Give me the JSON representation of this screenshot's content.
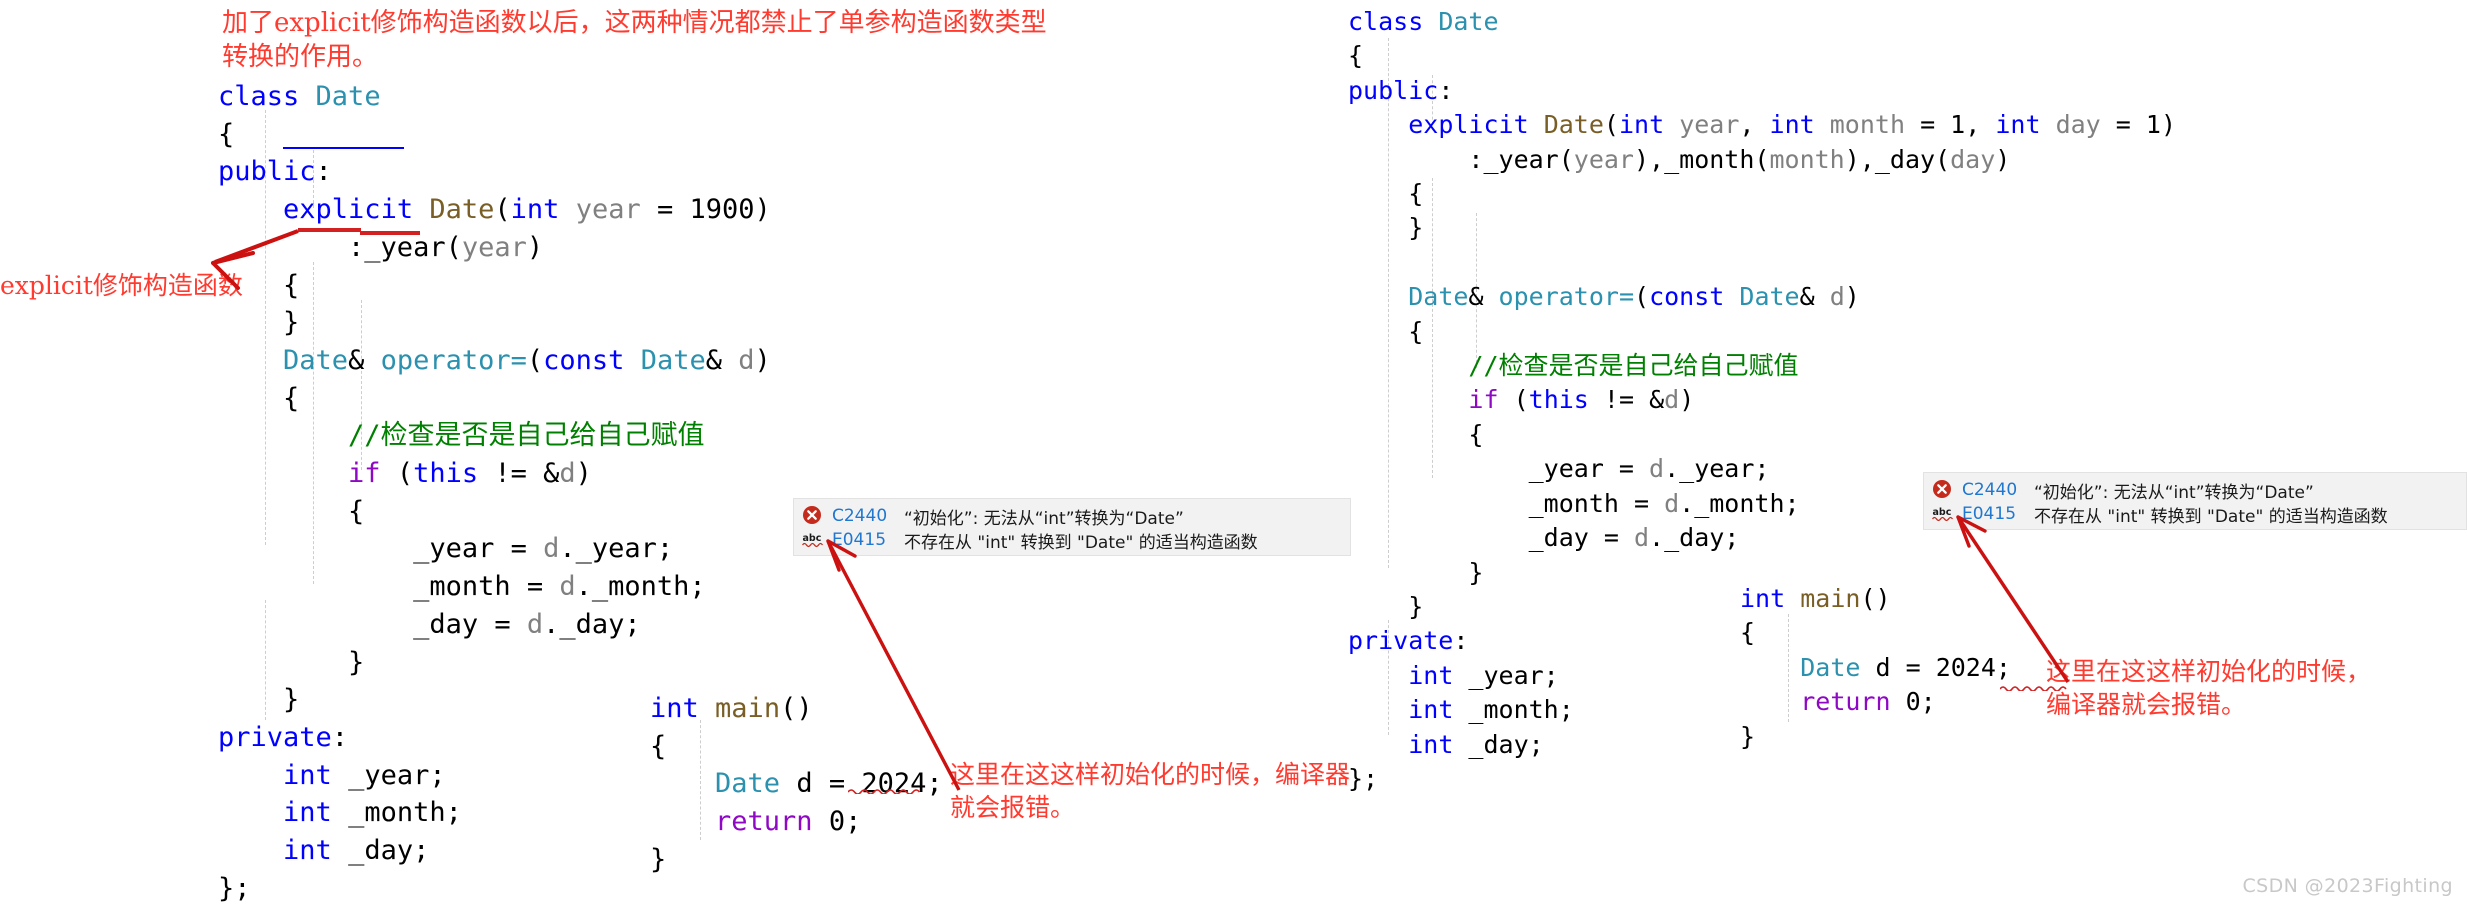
{
  "header_note": "加了explicit修饰构造函数以后，这两种情况都禁止了单参构造函数类型转换的作用。",
  "left_side_note": "explicit修饰构造函数",
  "watermark": "CSDN @2023Fighting",
  "colors": {
    "keyword": "#0000ff",
    "type": "#2b91af",
    "function": "#795e26",
    "variable": "#808080",
    "control": "#8f08c4",
    "comment": "#008000",
    "annotation_red": "#ff3b30",
    "arrow_red": "#cc1111",
    "error_code_blue": "#1f77d0",
    "tooltip_bg": "#f2f2f2",
    "background": "#ffffff"
  },
  "left_panel": {
    "lines": [
      [
        {
          "t": "class",
          "c": "kw"
        },
        {
          "t": " ",
          "c": "plain"
        },
        {
          "t": "Date",
          "c": "type"
        }
      ],
      [
        {
          "t": "{",
          "c": "plain"
        }
      ],
      [
        {
          "t": "public",
          "c": "kw"
        },
        {
          "t": ":",
          "c": "plain"
        }
      ],
      [
        {
          "t": "    ",
          "c": "plain"
        },
        {
          "t": "explicit",
          "c": "kw"
        },
        {
          "t": " ",
          "c": "plain"
        },
        {
          "t": "Date",
          "c": "fn"
        },
        {
          "t": "(",
          "c": "plain"
        },
        {
          "t": "int",
          "c": "kw"
        },
        {
          "t": " ",
          "c": "plain"
        },
        {
          "t": "year",
          "c": "var"
        },
        {
          "t": " = ",
          "c": "plain"
        },
        {
          "t": "1900",
          "c": "num"
        },
        {
          "t": ")",
          "c": "plain"
        }
      ],
      [
        {
          "t": "        :_year",
          "c": "plain"
        },
        {
          "t": "(",
          "c": "plain"
        },
        {
          "t": "year",
          "c": "var"
        },
        {
          "t": ")",
          "c": "plain"
        }
      ],
      [
        {
          "t": "    {",
          "c": "plain"
        }
      ],
      [
        {
          "t": "    }",
          "c": "plain"
        }
      ],
      [
        {
          "t": "    ",
          "c": "plain"
        },
        {
          "t": "Date",
          "c": "type"
        },
        {
          "t": "& ",
          "c": "plain"
        },
        {
          "t": "operator=",
          "c": "type"
        },
        {
          "t": "(",
          "c": "plain"
        },
        {
          "t": "const",
          "c": "kw"
        },
        {
          "t": " ",
          "c": "plain"
        },
        {
          "t": "Date",
          "c": "type"
        },
        {
          "t": "& ",
          "c": "plain"
        },
        {
          "t": "d",
          "c": "var"
        },
        {
          "t": ")",
          "c": "plain"
        }
      ],
      [
        {
          "t": "    {",
          "c": "plain"
        }
      ],
      [
        {
          "t": "        ",
          "c": "plain"
        },
        {
          "t": "//检查是否是自己给自己赋值",
          "c": "cmt"
        }
      ],
      [
        {
          "t": "        ",
          "c": "plain"
        },
        {
          "t": "if",
          "c": "ctrl"
        },
        {
          "t": " (",
          "c": "plain"
        },
        {
          "t": "this",
          "c": "kw"
        },
        {
          "t": " != &",
          "c": "plain"
        },
        {
          "t": "d",
          "c": "var"
        },
        {
          "t": ")",
          "c": "plain"
        }
      ],
      [
        {
          "t": "        {",
          "c": "plain"
        }
      ],
      [
        {
          "t": "            _year = ",
          "c": "plain"
        },
        {
          "t": "d",
          "c": "var"
        },
        {
          "t": "._year;",
          "c": "plain"
        }
      ],
      [
        {
          "t": "            _month = ",
          "c": "plain"
        },
        {
          "t": "d",
          "c": "var"
        },
        {
          "t": "._month;",
          "c": "plain"
        }
      ],
      [
        {
          "t": "            _day = ",
          "c": "plain"
        },
        {
          "t": "d",
          "c": "var"
        },
        {
          "t": "._day;",
          "c": "plain"
        }
      ],
      [
        {
          "t": "        }",
          "c": "plain"
        }
      ],
      [
        {
          "t": "    }",
          "c": "plain"
        }
      ],
      [
        {
          "t": "private",
          "c": "kw"
        },
        {
          "t": ":",
          "c": "plain"
        }
      ],
      [
        {
          "t": "    ",
          "c": "plain"
        },
        {
          "t": "int",
          "c": "kw"
        },
        {
          "t": " _year;",
          "c": "plain"
        }
      ],
      [
        {
          "t": "    ",
          "c": "plain"
        },
        {
          "t": "int",
          "c": "kw"
        },
        {
          "t": " _month;",
          "c": "plain"
        }
      ],
      [
        {
          "t": "    ",
          "c": "plain"
        },
        {
          "t": "int",
          "c": "kw"
        },
        {
          "t": " _day;",
          "c": "plain"
        }
      ],
      [
        {
          "t": "};",
          "c": "plain"
        }
      ]
    ]
  },
  "left_main": {
    "lines": [
      [
        {
          "t": "int",
          "c": "kw"
        },
        {
          "t": " ",
          "c": "plain"
        },
        {
          "t": "main",
          "c": "fn"
        },
        {
          "t": "()",
          "c": "plain"
        }
      ],
      [
        {
          "t": "{",
          "c": "plain"
        }
      ],
      [
        {
          "t": "    ",
          "c": "plain"
        },
        {
          "t": "Date",
          "c": "type"
        },
        {
          "t": " d = ",
          "c": "plain"
        },
        {
          "t": "2024",
          "c": "num"
        },
        {
          "t": ";",
          "c": "plain"
        }
      ],
      [
        {
          "t": "    ",
          "c": "plain"
        },
        {
          "t": "return",
          "c": "ctrl"
        },
        {
          "t": " ",
          "c": "plain"
        },
        {
          "t": "0",
          "c": "num"
        },
        {
          "t": ";",
          "c": "plain"
        }
      ],
      [
        {
          "t": "}",
          "c": "plain"
        }
      ]
    ]
  },
  "right_panel": {
    "lines": [
      [
        {
          "t": "class",
          "c": "kw"
        },
        {
          "t": " ",
          "c": "plain"
        },
        {
          "t": "Date",
          "c": "type"
        }
      ],
      [
        {
          "t": "{",
          "c": "plain"
        }
      ],
      [
        {
          "t": "public",
          "c": "kw"
        },
        {
          "t": ":",
          "c": "plain"
        }
      ],
      [
        {
          "t": "    ",
          "c": "plain"
        },
        {
          "t": "explicit",
          "c": "kw"
        },
        {
          "t": " ",
          "c": "plain"
        },
        {
          "t": "Date",
          "c": "fn"
        },
        {
          "t": "(",
          "c": "plain"
        },
        {
          "t": "int",
          "c": "kw"
        },
        {
          "t": " ",
          "c": "plain"
        },
        {
          "t": "year",
          "c": "var"
        },
        {
          "t": ", ",
          "c": "plain"
        },
        {
          "t": "int",
          "c": "kw"
        },
        {
          "t": " ",
          "c": "plain"
        },
        {
          "t": "month",
          "c": "var"
        },
        {
          "t": " = ",
          "c": "plain"
        },
        {
          "t": "1",
          "c": "num"
        },
        {
          "t": ", ",
          "c": "plain"
        },
        {
          "t": "int",
          "c": "kw"
        },
        {
          "t": " ",
          "c": "plain"
        },
        {
          "t": "day",
          "c": "var"
        },
        {
          "t": " = ",
          "c": "plain"
        },
        {
          "t": "1",
          "c": "num"
        },
        {
          "t": ")",
          "c": "plain"
        }
      ],
      [
        {
          "t": "        :_year",
          "c": "plain"
        },
        {
          "t": "(",
          "c": "plain"
        },
        {
          "t": "year",
          "c": "var"
        },
        {
          "t": "),_month(",
          "c": "plain"
        },
        {
          "t": "month",
          "c": "var"
        },
        {
          "t": "),_day(",
          "c": "plain"
        },
        {
          "t": "day",
          "c": "var"
        },
        {
          "t": ")",
          "c": "plain"
        }
      ],
      [
        {
          "t": "    {",
          "c": "plain"
        }
      ],
      [
        {
          "t": "    }",
          "c": "plain"
        }
      ],
      [
        {
          "t": "",
          "c": "plain"
        }
      ],
      [
        {
          "t": "    ",
          "c": "plain"
        },
        {
          "t": "Date",
          "c": "type"
        },
        {
          "t": "& ",
          "c": "plain"
        },
        {
          "t": "operator=",
          "c": "type"
        },
        {
          "t": "(",
          "c": "plain"
        },
        {
          "t": "const",
          "c": "kw"
        },
        {
          "t": " ",
          "c": "plain"
        },
        {
          "t": "Date",
          "c": "type"
        },
        {
          "t": "& ",
          "c": "plain"
        },
        {
          "t": "d",
          "c": "var"
        },
        {
          "t": ")",
          "c": "plain"
        }
      ],
      [
        {
          "t": "    {",
          "c": "plain"
        }
      ],
      [
        {
          "t": "        ",
          "c": "plain"
        },
        {
          "t": "//检查是否是自己给自己赋值",
          "c": "cmt"
        }
      ],
      [
        {
          "t": "        ",
          "c": "plain"
        },
        {
          "t": "if",
          "c": "ctrl"
        },
        {
          "t": " (",
          "c": "plain"
        },
        {
          "t": "this",
          "c": "kw"
        },
        {
          "t": " != &",
          "c": "plain"
        },
        {
          "t": "d",
          "c": "var"
        },
        {
          "t": ")",
          "c": "plain"
        }
      ],
      [
        {
          "t": "        {",
          "c": "plain"
        }
      ],
      [
        {
          "t": "            _year = ",
          "c": "plain"
        },
        {
          "t": "d",
          "c": "var"
        },
        {
          "t": "._year;",
          "c": "plain"
        }
      ],
      [
        {
          "t": "            _month = ",
          "c": "plain"
        },
        {
          "t": "d",
          "c": "var"
        },
        {
          "t": "._month;",
          "c": "plain"
        }
      ],
      [
        {
          "t": "            _day = ",
          "c": "plain"
        },
        {
          "t": "d",
          "c": "var"
        },
        {
          "t": "._day;",
          "c": "plain"
        }
      ],
      [
        {
          "t": "        }",
          "c": "plain"
        }
      ],
      [
        {
          "t": "    }",
          "c": "plain"
        }
      ],
      [
        {
          "t": "private",
          "c": "kw"
        },
        {
          "t": ":",
          "c": "plain"
        }
      ],
      [
        {
          "t": "    ",
          "c": "plain"
        },
        {
          "t": "int",
          "c": "kw"
        },
        {
          "t": " _year;",
          "c": "plain"
        }
      ],
      [
        {
          "t": "    ",
          "c": "plain"
        },
        {
          "t": "int",
          "c": "kw"
        },
        {
          "t": " _month;",
          "c": "plain"
        }
      ],
      [
        {
          "t": "    ",
          "c": "plain"
        },
        {
          "t": "int",
          "c": "kw"
        },
        {
          "t": " _day;",
          "c": "plain"
        }
      ],
      [
        {
          "t": "};",
          "c": "plain"
        }
      ]
    ]
  },
  "right_main": {
    "lines": [
      [
        {
          "t": "int",
          "c": "kw"
        },
        {
          "t": " ",
          "c": "plain"
        },
        {
          "t": "main",
          "c": "fn"
        },
        {
          "t": "()",
          "c": "plain"
        }
      ],
      [
        {
          "t": "{",
          "c": "plain"
        }
      ],
      [
        {
          "t": "    ",
          "c": "plain"
        },
        {
          "t": "Date",
          "c": "type"
        },
        {
          "t": " d = ",
          "c": "plain"
        },
        {
          "t": "2024",
          "c": "num"
        },
        {
          "t": ";",
          "c": "plain"
        }
      ],
      [
        {
          "t": "    ",
          "c": "plain"
        },
        {
          "t": "return",
          "c": "ctrl"
        },
        {
          "t": " ",
          "c": "plain"
        },
        {
          "t": "0",
          "c": "num"
        },
        {
          "t": ";",
          "c": "plain"
        }
      ],
      [
        {
          "t": "}",
          "c": "plain"
        }
      ]
    ]
  },
  "error_tooltip": {
    "rows": [
      {
        "icon": "error-x-icon",
        "code": "C2440",
        "message": "“初始化”: 无法从“int”转换为“Date”"
      },
      {
        "icon": "abc-squiggle-icon",
        "code": "E0415",
        "message": "不存在从 \"int\" 转换到 \"Date\" 的适当构造函数"
      }
    ]
  },
  "annotations": {
    "left_error_note": "这里在这这样初始化的时候，编译器就会报错。",
    "right_error_note": "这里在这这样初始化的时候，编译器就会报错。"
  }
}
